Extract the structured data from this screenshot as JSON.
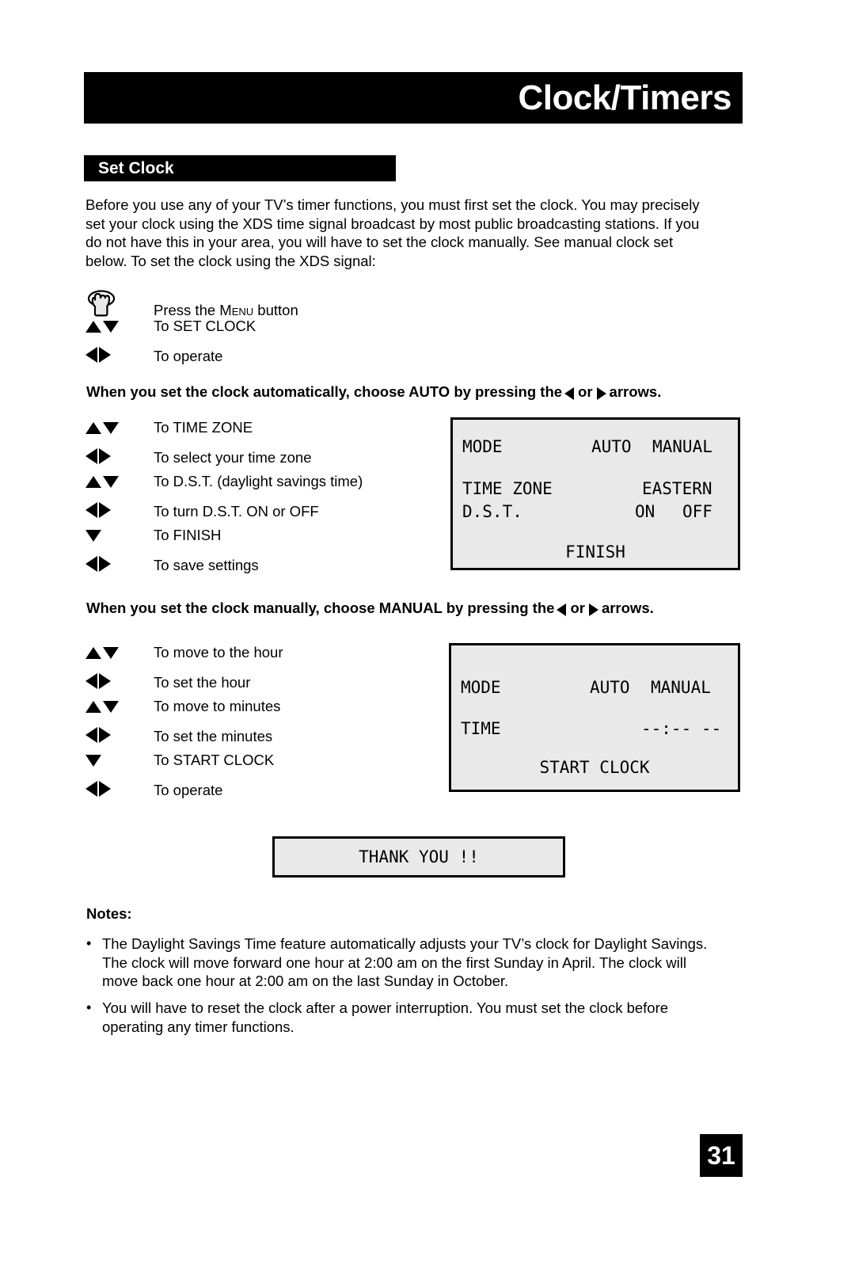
{
  "header": {
    "title": "Clock/Timers"
  },
  "section": {
    "title": "Set Clock"
  },
  "intro": {
    "line1": "Before you use any of your TV’s timer functions, you must first set the clock. You may precisely",
    "line2": "set your clock using the XDS time signal broadcast by most public broadcasting stations. If you",
    "line3": "do not have this in your area, you will have to set the clock manually. See manual clock set",
    "line4": "below. To set the clock using the XDS signal:"
  },
  "steps_intro": [
    {
      "icon": "hand-press-icon",
      "text_pre": "Press the ",
      "text_caps": "Menu",
      "text_post": " button",
      "text": "Press the MENU button"
    },
    {
      "icon": "up-down-arrows-icon",
      "text": "To SET CLOCK"
    },
    {
      "icon": "left-right-arrows-icon",
      "text": "To operate"
    }
  ],
  "callout_auto": {
    "part1": "When you set the clock automatically, choose AUTO by pressing the",
    "part2": "or",
    "part3": "arrows."
  },
  "steps_auto": [
    {
      "icon": "up-down-arrows-icon",
      "text": "To TIME ZONE"
    },
    {
      "icon": "left-right-arrows-icon",
      "text": "To select your time zone"
    },
    {
      "icon": "up-down-arrows-icon",
      "text": "To D.S.T. (daylight savings time)"
    },
    {
      "icon": "left-right-arrows-icon",
      "text": "To turn D.S.T. ON or OFF"
    },
    {
      "icon": "down-arrow-icon",
      "text": "To FINISH"
    },
    {
      "icon": "left-right-arrows-icon",
      "text": "To save settings"
    }
  ],
  "osd_auto": {
    "mode_label": "MODE",
    "mode_option_auto": "AUTO",
    "mode_option_manual": "MANUAL",
    "timezone_label": "TIME ZONE",
    "timezone_value": "EASTERN",
    "dst_label": "D.S.T.",
    "dst_option_on": "ON",
    "dst_option_off": "OFF",
    "finish_label": "FINISH"
  },
  "callout_manual": {
    "part1": "When you set the clock manually, choose MANUAL by pressing the",
    "part2": "or",
    "part3": "arrows."
  },
  "steps_manual": [
    {
      "icon": "up-down-arrows-icon",
      "text": "To move to the hour"
    },
    {
      "icon": "left-right-arrows-icon",
      "text": "To set the hour"
    },
    {
      "icon": "up-down-arrows-icon",
      "text": "To move to minutes"
    },
    {
      "icon": "left-right-arrows-icon",
      "text": "To set the minutes"
    },
    {
      "icon": "down-arrow-icon",
      "text": "To START CLOCK"
    },
    {
      "icon": "left-right-arrows-icon",
      "text": "To operate"
    }
  ],
  "osd_manual": {
    "mode_label": "MODE",
    "mode_option_auto": "AUTO",
    "mode_option_manual": "MANUAL",
    "time_label": "TIME",
    "time_value": "--:-- --",
    "start_clock_label": "START CLOCK"
  },
  "thank_you": {
    "text": "THANK YOU !!"
  },
  "notes": {
    "title": "Notes:",
    "bullet": "•",
    "items": [
      {
        "line1": "The Daylight Savings Time feature automatically adjusts your TV’s clock for Daylight Savings.",
        "line2": "The clock will move forward one hour at 2:00 am on the first Sunday in April. The clock will",
        "line3": "move back one hour at 2:00 am on the last Sunday in October."
      },
      {
        "line1": "You will have to reset the clock after a power interruption. You must set the clock before",
        "line2": "operating any timer functions."
      }
    ]
  },
  "footer": {
    "page_number": "31"
  },
  "colors": {
    "bar_black": "#000000",
    "osd_fill": "#e9e9e9",
    "page_bg": "#ffffff"
  }
}
